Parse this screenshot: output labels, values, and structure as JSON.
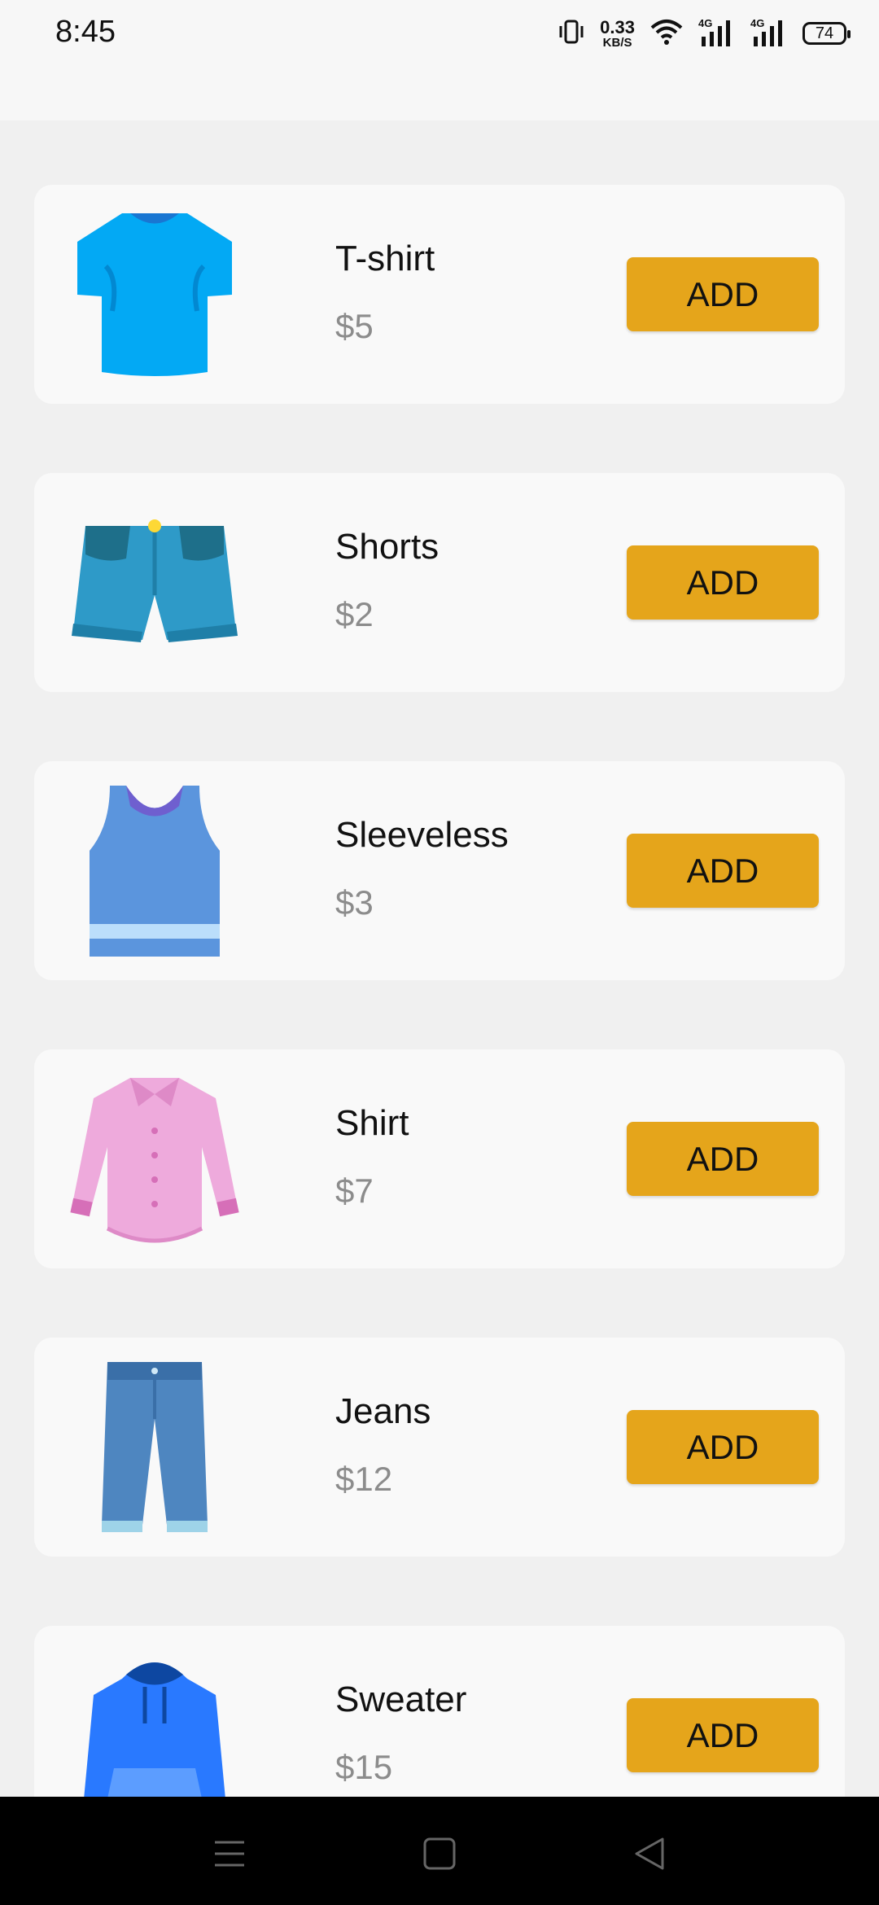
{
  "status": {
    "time": "8:45",
    "speed_value": "0.33",
    "speed_unit": "KB/S",
    "network_1": "4G",
    "network_2": "4G",
    "battery": "74"
  },
  "products": [
    {
      "name": "T-shirt",
      "price": "$5",
      "button": "ADD",
      "icon": "tshirt-icon",
      "color": "#03a9f4"
    },
    {
      "name": "Shorts",
      "price": "$2",
      "button": "ADD",
      "icon": "shorts-icon",
      "color": "#2e9ac8"
    },
    {
      "name": "Sleeveless",
      "price": "$3",
      "button": "ADD",
      "icon": "tank-top-icon",
      "color": "#5b95dd"
    },
    {
      "name": "Shirt",
      "price": "$7",
      "button": "ADD",
      "icon": "shirt-icon",
      "color": "#eeaadc"
    },
    {
      "name": "Jeans",
      "price": "$12",
      "button": "ADD",
      "icon": "jeans-icon",
      "color": "#4e86c0"
    },
    {
      "name": "Sweater",
      "price": "$15",
      "button": "ADD",
      "icon": "hoodie-icon",
      "color": "#2979ff"
    }
  ],
  "colors": {
    "button": "#e5a51b",
    "card": "#f9f9f9",
    "background": "#f0f0f0",
    "price_text": "#8c8c8c"
  },
  "navbar": {
    "menu_icon": "menu-icon",
    "home_icon": "home-icon",
    "back_icon": "back-icon"
  }
}
